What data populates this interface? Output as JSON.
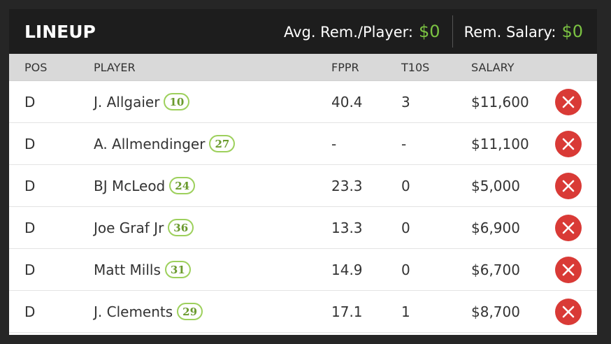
{
  "header": {
    "title": "LINEUP",
    "avg_label": "Avg. Rem./Player:",
    "avg_value": "$0",
    "rem_label": "Rem. Salary:",
    "rem_value": "$0"
  },
  "columns": {
    "pos": "POS",
    "player": "PLAYER",
    "fppr": "FPPR",
    "t10s": "T10S",
    "salary": "SALARY"
  },
  "rows": [
    {
      "pos": "D",
      "player": "J. Allgaier",
      "number": "10",
      "fppr": "40.4",
      "t10s": "3",
      "salary": "$11,600"
    },
    {
      "pos": "D",
      "player": "A. Allmendinger",
      "number": "27",
      "fppr": "-",
      "t10s": "-",
      "salary": "$11,100"
    },
    {
      "pos": "D",
      "player": "BJ McLeod",
      "number": "24",
      "fppr": "23.3",
      "t10s": "0",
      "salary": "$5,000"
    },
    {
      "pos": "D",
      "player": "Joe Graf Jr",
      "number": "36",
      "fppr": "13.3",
      "t10s": "0",
      "salary": "$6,900"
    },
    {
      "pos": "D",
      "player": "Matt Mills",
      "number": "31",
      "fppr": "14.9",
      "t10s": "0",
      "salary": "$6,700"
    },
    {
      "pos": "D",
      "player": "J. Clements",
      "number": "29",
      "fppr": "17.1",
      "t10s": "1",
      "salary": "$8,700"
    }
  ],
  "icons": {
    "remove": "close-circle-icon"
  },
  "colors": {
    "accent_green": "#7bc242",
    "remove_red": "#d93a36",
    "header_bg": "#1d1d1d"
  }
}
